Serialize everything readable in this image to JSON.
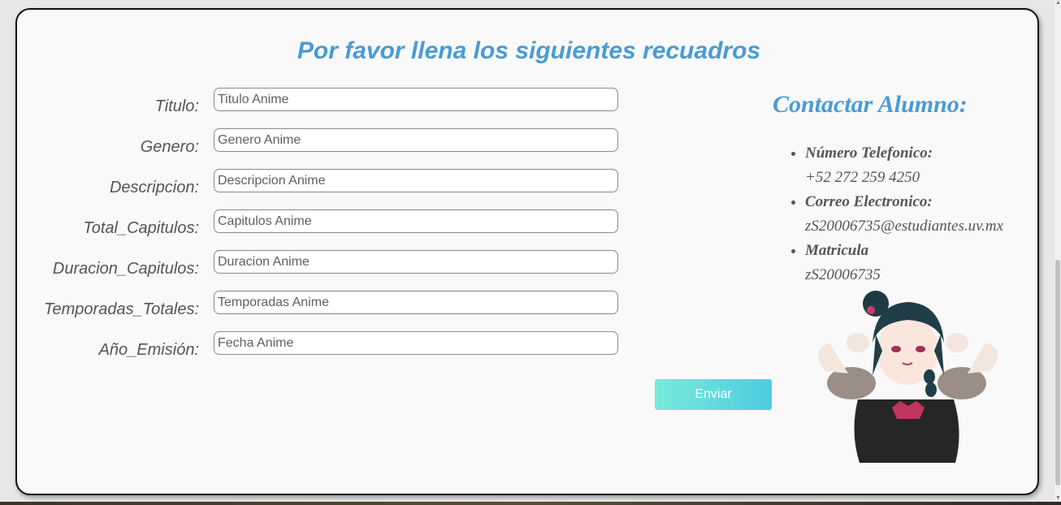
{
  "page": {
    "heading": "Por favor llena los siguientes recuadros",
    "submit_label": "Enviar"
  },
  "form": {
    "fields": [
      {
        "label": "Titulo:",
        "placeholder": "Titulo Anime"
      },
      {
        "label": "Genero:",
        "placeholder": "Genero Anime"
      },
      {
        "label": "Descripcion:",
        "placeholder": "Descripcion Anime"
      },
      {
        "label": "Total_Capitulos:",
        "placeholder": "Capitulos Anime"
      },
      {
        "label": "Duracion_Capitulos:",
        "placeholder": "Duracion Anime"
      },
      {
        "label": "Temporadas_Totales:",
        "placeholder": "Temporadas Anime"
      },
      {
        "label": "Año_Emisión:",
        "placeholder": "Fecha Anime"
      }
    ]
  },
  "contact": {
    "heading": "Contactar Alumno:",
    "items": [
      {
        "label": "Número Telefonico:",
        "value": "+52 272 259 4250"
      },
      {
        "label": "Correo Electronico:",
        "value": "zS20006735@estudiantes.uv.mx"
      },
      {
        "label": "Matricula",
        "value": "zS20006735"
      }
    ]
  },
  "colors": {
    "heading": "#4a9bd3",
    "button_start": "#78eadb",
    "button_end": "#4fcbe0",
    "text": "#555555"
  },
  "icons": {
    "image": "anime-girl-illustration"
  }
}
